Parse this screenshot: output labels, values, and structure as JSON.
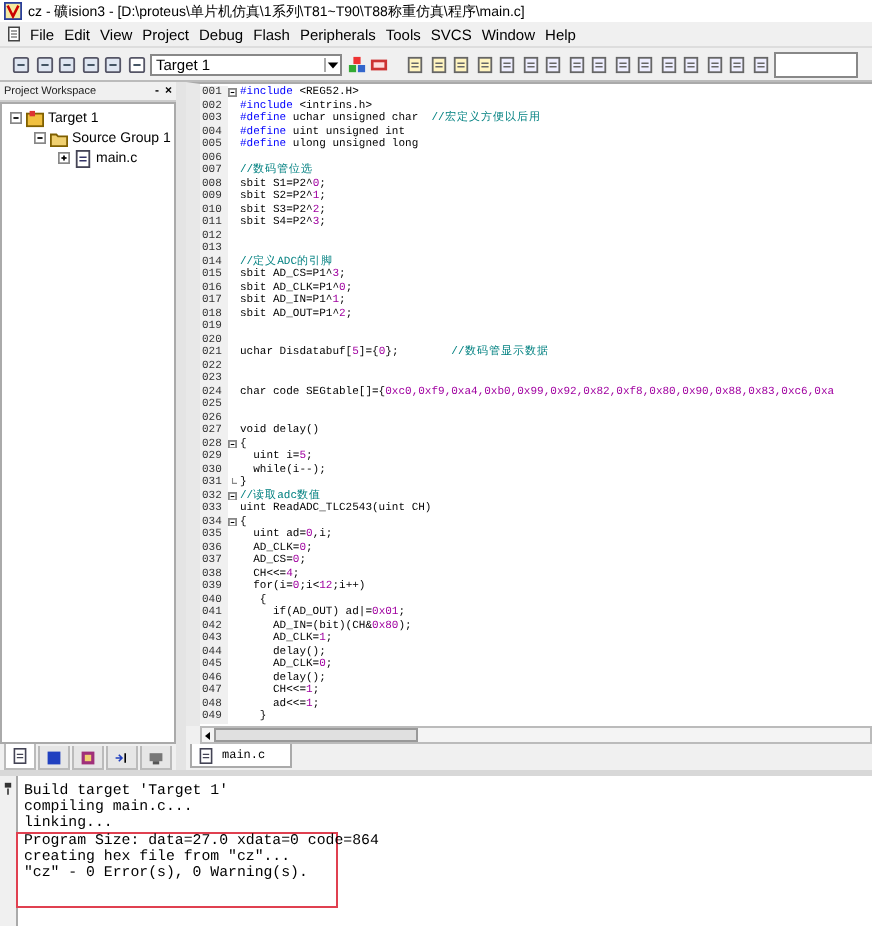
{
  "window": {
    "title": "cz - 礦ision3 - [D:\\proteus\\单片机仿真\\1系列\\T81~T90\\T88称重仿真\\程序\\main.c]"
  },
  "menu": [
    {
      "label": "File"
    },
    {
      "label": "Edit"
    },
    {
      "label": "View"
    },
    {
      "label": "Project"
    },
    {
      "label": "Debug"
    },
    {
      "label": "Flash"
    },
    {
      "label": "Peripherals"
    },
    {
      "label": "Tools"
    },
    {
      "label": "SVCS"
    },
    {
      "label": "Window"
    },
    {
      "label": "Help"
    }
  ],
  "toolbar": {
    "target_select": {
      "value": "Target 1"
    }
  },
  "workspace": {
    "title": "Project Workspace",
    "controls": [
      "-",
      "×"
    ],
    "tree": [
      {
        "label": "Target 1",
        "kind": "target",
        "expanded": true,
        "children": [
          {
            "label": "Source Group 1",
            "kind": "group",
            "expanded": true,
            "children": [
              {
                "label": "main.c",
                "kind": "file",
                "expanded": false
              }
            ]
          }
        ]
      }
    ],
    "tabs": [
      {
        "kind": "files",
        "selected": true
      },
      {
        "kind": "regs",
        "selected": false
      },
      {
        "kind": "books",
        "selected": false
      },
      {
        "kind": "functions",
        "selected": false
      },
      {
        "kind": "templates",
        "selected": false
      }
    ]
  },
  "editor": {
    "lines": [
      {
        "num": "001",
        "kind": "fold_start",
        "segs": [
          {
            "kind": "kw",
            "t": "#include"
          },
          {
            "kind": "p",
            "t": " <REG52.H>"
          }
        ]
      },
      {
        "num": "002",
        "kind": "plain",
        "segs": [
          {
            "kind": "kw",
            "t": "#include"
          },
          {
            "kind": "p",
            "t": " <intrins.h>"
          }
        ]
      },
      {
        "num": "003",
        "kind": "plain",
        "segs": [
          {
            "kind": "kw",
            "t": "#define"
          },
          {
            "kind": "p",
            "t": " uchar unsigned char  "
          },
          {
            "kind": "c",
            "t": "//宏定义方便以后用"
          }
        ]
      },
      {
        "num": "004",
        "kind": "plain",
        "segs": [
          {
            "kind": "kw",
            "t": "#define"
          },
          {
            "kind": "p",
            "t": " uint unsigned int"
          }
        ]
      },
      {
        "num": "005",
        "kind": "plain",
        "segs": [
          {
            "kind": "kw",
            "t": "#define"
          },
          {
            "kind": "p",
            "t": " ulong unsigned long"
          }
        ]
      },
      {
        "num": "006",
        "kind": "plain"
      },
      {
        "num": "007",
        "kind": "plain",
        "segs": [
          {
            "kind": "c",
            "t": "//数码管位选"
          }
        ]
      },
      {
        "num": "008",
        "kind": "plain",
        "segs": [
          {
            "kind": "p",
            "t": "sbit S1=P2^"
          },
          {
            "kind": "n",
            "t": "0"
          },
          {
            "kind": "p",
            "t": ";"
          }
        ]
      },
      {
        "num": "009",
        "kind": "plain",
        "segs": [
          {
            "kind": "p",
            "t": "sbit S2=P2^"
          },
          {
            "kind": "n",
            "t": "1"
          },
          {
            "kind": "p",
            "t": ";"
          }
        ]
      },
      {
        "num": "010",
        "kind": "plain",
        "segs": [
          {
            "kind": "p",
            "t": "sbit S3=P2^"
          },
          {
            "kind": "n",
            "t": "2"
          },
          {
            "kind": "p",
            "t": ";"
          }
        ]
      },
      {
        "num": "011",
        "kind": "plain",
        "segs": [
          {
            "kind": "p",
            "t": "sbit S4=P2^"
          },
          {
            "kind": "n",
            "t": "3"
          },
          {
            "kind": "p",
            "t": ";"
          }
        ]
      },
      {
        "num": "012",
        "kind": "plain"
      },
      {
        "num": "013",
        "kind": "plain"
      },
      {
        "num": "014",
        "kind": "plain",
        "segs": [
          {
            "kind": "c",
            "t": "//定义ADC的引脚"
          }
        ]
      },
      {
        "num": "015",
        "kind": "plain",
        "segs": [
          {
            "kind": "p",
            "t": "sbit AD_CS=P1^"
          },
          {
            "kind": "n",
            "t": "3"
          },
          {
            "kind": "p",
            "t": ";"
          }
        ]
      },
      {
        "num": "016",
        "kind": "plain",
        "segs": [
          {
            "kind": "p",
            "t": "sbit AD_CLK=P1^"
          },
          {
            "kind": "n",
            "t": "0"
          },
          {
            "kind": "p",
            "t": ";"
          }
        ]
      },
      {
        "num": "017",
        "kind": "plain",
        "segs": [
          {
            "kind": "p",
            "t": "sbit AD_IN=P1^"
          },
          {
            "kind": "n",
            "t": "1"
          },
          {
            "kind": "p",
            "t": ";"
          }
        ]
      },
      {
        "num": "018",
        "kind": "plain",
        "segs": [
          {
            "kind": "p",
            "t": "sbit AD_OUT=P1^"
          },
          {
            "kind": "n",
            "t": "2"
          },
          {
            "kind": "p",
            "t": ";"
          }
        ]
      },
      {
        "num": "019",
        "kind": "plain"
      },
      {
        "num": "020",
        "kind": "plain"
      },
      {
        "num": "021",
        "kind": "plain",
        "segs": [
          {
            "kind": "p",
            "t": "uchar Disdatabuf["
          },
          {
            "kind": "n",
            "t": "5"
          },
          {
            "kind": "p",
            "t": "]={"
          },
          {
            "kind": "n",
            "t": "0"
          },
          {
            "kind": "p",
            "t": "};        "
          },
          {
            "kind": "c",
            "t": "//数码管显示数据"
          }
        ]
      },
      {
        "num": "022",
        "kind": "plain"
      },
      {
        "num": "023",
        "kind": "plain"
      },
      {
        "num": "024",
        "kind": "plain",
        "segs": [
          {
            "kind": "p",
            "t": "char code SEGtable[]={"
          },
          {
            "kind": "n",
            "t": "0xc0,0xf9,0xa4,0xb0,0x99,0x92,0x82,0xf8,0x80,0x90,0x88,0x83,0xc6,0xa"
          }
        ]
      },
      {
        "num": "025",
        "kind": "plain"
      },
      {
        "num": "026",
        "kind": "plain"
      },
      {
        "num": "027",
        "kind": "plain",
        "segs": [
          {
            "kind": "p",
            "t": "void delay()"
          }
        ]
      },
      {
        "num": "028",
        "kind": "fold_start",
        "segs": [
          {
            "kind": "p",
            "t": "{"
          }
        ]
      },
      {
        "num": "029",
        "kind": "plain",
        "segs": [
          {
            "kind": "p",
            "t": "  uint i="
          },
          {
            "kind": "n",
            "t": "5"
          },
          {
            "kind": "p",
            "t": ";"
          }
        ]
      },
      {
        "num": "030",
        "kind": "plain",
        "segs": [
          {
            "kind": "p",
            "t": "  while(i--);"
          }
        ]
      },
      {
        "num": "031",
        "kind": "fold_end",
        "segs": [
          {
            "kind": "p",
            "t": "}"
          }
        ]
      },
      {
        "num": "032",
        "kind": "fold_start",
        "segs": [
          {
            "kind": "c",
            "t": "//读取adc数值"
          }
        ]
      },
      {
        "num": "033",
        "kind": "plain",
        "segs": [
          {
            "kind": "p",
            "t": "uint ReadADC_TLC2543(uint CH)"
          }
        ]
      },
      {
        "num": "034",
        "kind": "fold_start",
        "segs": [
          {
            "kind": "p",
            "t": "{"
          }
        ]
      },
      {
        "num": "035",
        "kind": "plain",
        "segs": [
          {
            "kind": "p",
            "t": "  uint ad="
          },
          {
            "kind": "n",
            "t": "0"
          },
          {
            "kind": "p",
            "t": ",i;"
          }
        ]
      },
      {
        "num": "036",
        "kind": "plain",
        "segs": [
          {
            "kind": "p",
            "t": "  AD_CLK="
          },
          {
            "kind": "n",
            "t": "0"
          },
          {
            "kind": "p",
            "t": ";"
          }
        ]
      },
      {
        "num": "037",
        "kind": "plain",
        "segs": [
          {
            "kind": "p",
            "t": "  AD_CS="
          },
          {
            "kind": "n",
            "t": "0"
          },
          {
            "kind": "p",
            "t": ";"
          }
        ]
      },
      {
        "num": "038",
        "kind": "plain",
        "segs": [
          {
            "kind": "p",
            "t": "  CH<<="
          },
          {
            "kind": "n",
            "t": "4"
          },
          {
            "kind": "p",
            "t": ";"
          }
        ]
      },
      {
        "num": "039",
        "kind": "plain",
        "segs": [
          {
            "kind": "p",
            "t": "  for(i="
          },
          {
            "kind": "n",
            "t": "0"
          },
          {
            "kind": "p",
            "t": ";i<"
          },
          {
            "kind": "n",
            "t": "12"
          },
          {
            "kind": "p",
            "t": ";i++)"
          }
        ]
      },
      {
        "num": "040",
        "kind": "plain",
        "segs": [
          {
            "kind": "p",
            "t": "   {"
          }
        ]
      },
      {
        "num": "041",
        "kind": "plain",
        "segs": [
          {
            "kind": "p",
            "t": "     if(AD_OUT) ad|="
          },
          {
            "kind": "n",
            "t": "0x01"
          },
          {
            "kind": "p",
            "t": ";"
          }
        ]
      },
      {
        "num": "042",
        "kind": "plain",
        "segs": [
          {
            "kind": "p",
            "t": "     AD_IN=(bit)(CH&"
          },
          {
            "kind": "n",
            "t": "0x80"
          },
          {
            "kind": "p",
            "t": ");"
          }
        ]
      },
      {
        "num": "043",
        "kind": "plain",
        "segs": [
          {
            "kind": "p",
            "t": "     AD_CLK="
          },
          {
            "kind": "n",
            "t": "1"
          },
          {
            "kind": "p",
            "t": ";"
          }
        ]
      },
      {
        "num": "044",
        "kind": "plain",
        "segs": [
          {
            "kind": "p",
            "t": "     delay();"
          }
        ]
      },
      {
        "num": "045",
        "kind": "plain",
        "segs": [
          {
            "kind": "p",
            "t": "     AD_CLK="
          },
          {
            "kind": "n",
            "t": "0"
          },
          {
            "kind": "p",
            "t": ";"
          }
        ]
      },
      {
        "num": "046",
        "kind": "plain",
        "segs": [
          {
            "kind": "p",
            "t": "     delay();"
          }
        ]
      },
      {
        "num": "047",
        "kind": "plain",
        "segs": [
          {
            "kind": "p",
            "t": "     CH<<="
          },
          {
            "kind": "n",
            "t": "1"
          },
          {
            "kind": "p",
            "t": ";"
          }
        ]
      },
      {
        "num": "048",
        "kind": "plain",
        "segs": [
          {
            "kind": "p",
            "t": "     ad<<="
          },
          {
            "kind": "n",
            "t": "1"
          },
          {
            "kind": "p",
            "t": ";"
          }
        ]
      },
      {
        "num": "049",
        "kind": "plain",
        "segs": [
          {
            "kind": "p",
            "t": "   }"
          }
        ]
      }
    ]
  },
  "editor_tabs": [
    {
      "label": "main.c",
      "selected": true
    }
  ],
  "output": {
    "lines": [
      "Build target 'Target 1'",
      "compiling main.c...",
      "linking..."
    ],
    "highlighted_lines": [
      "Program Size: data=27.0 xdata=0 code=864",
      "creating hex file from \"cz\"...",
      "\"cz\" - 0 Error(s), 0 Warning(s)."
    ]
  }
}
